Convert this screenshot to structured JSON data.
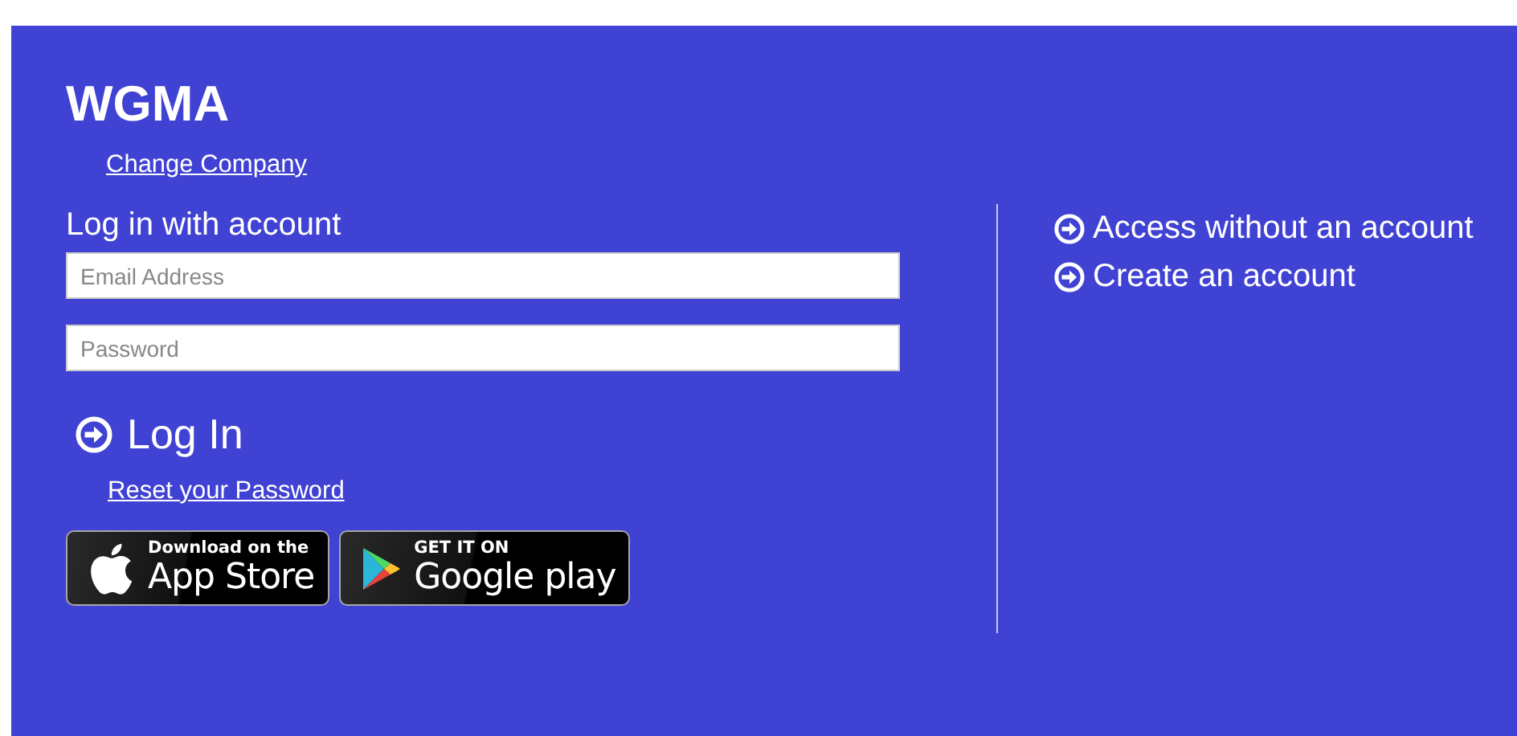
{
  "brand": "WGMA",
  "change_company": "Change Company",
  "login": {
    "heading": "Log in with account",
    "email": {
      "placeholder": "Email Address"
    },
    "password": {
      "placeholder": "Password"
    },
    "button": "Log In",
    "reset": "Reset your Password"
  },
  "stores": [
    {
      "kind": "apple",
      "small": "Download on the",
      "big": "App Store"
    },
    {
      "kind": "google",
      "small": "GET IT ON",
      "big": "Google play"
    }
  ],
  "options": [
    "Access without an account",
    "Create an account"
  ]
}
